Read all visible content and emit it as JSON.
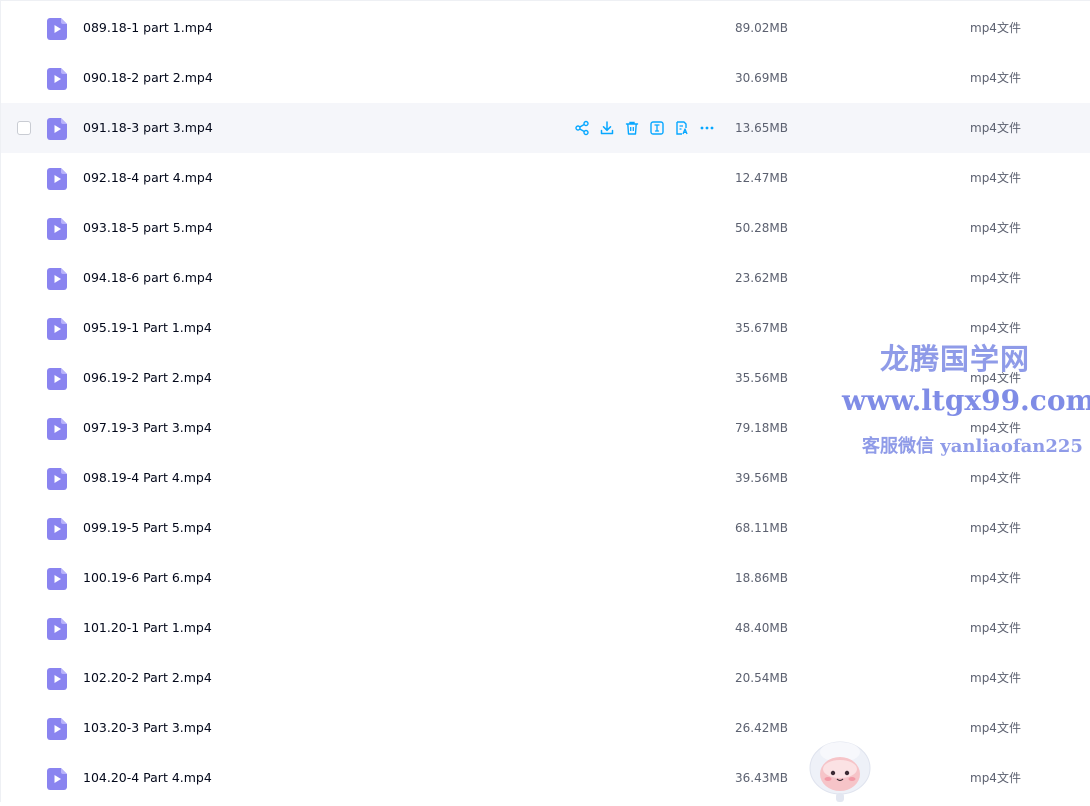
{
  "files": [
    {
      "name": "089.18-1 part 1.mp4",
      "size": "89.02MB",
      "type": "mp4文件"
    },
    {
      "name": "090.18-2 part 2.mp4",
      "size": "30.69MB",
      "type": "mp4文件"
    },
    {
      "name": "091.18-3 part 3.mp4",
      "size": "13.65MB",
      "type": "mp4文件",
      "hovered": true
    },
    {
      "name": "092.18-4 part 4.mp4",
      "size": "12.47MB",
      "type": "mp4文件"
    },
    {
      "name": "093.18-5 part 5.mp4",
      "size": "50.28MB",
      "type": "mp4文件"
    },
    {
      "name": "094.18-6 part 6.mp4",
      "size": "23.62MB",
      "type": "mp4文件"
    },
    {
      "name": "095.19-1 Part 1.mp4",
      "size": "35.67MB",
      "type": "mp4文件"
    },
    {
      "name": "096.19-2 Part 2.mp4",
      "size": "35.56MB",
      "type": "mp4文件"
    },
    {
      "name": "097.19-3 Part 3.mp4",
      "size": "79.18MB",
      "type": "mp4文件"
    },
    {
      "name": "098.19-4 Part 4.mp4",
      "size": "39.56MB",
      "type": "mp4文件"
    },
    {
      "name": "099.19-5 Part 5.mp4",
      "size": "68.11MB",
      "type": "mp4文件"
    },
    {
      "name": "100.19-6 Part 6.mp4",
      "size": "18.86MB",
      "type": "mp4文件"
    },
    {
      "name": "101.20-1 Part 1.mp4",
      "size": "48.40MB",
      "type": "mp4文件"
    },
    {
      "name": "102.20-2 Part 2.mp4",
      "size": "20.54MB",
      "type": "mp4文件"
    },
    {
      "name": "103.20-3 Part 3.mp4",
      "size": "26.42MB",
      "type": "mp4文件"
    },
    {
      "name": "104.20-4 Part 4.mp4",
      "size": "36.43MB",
      "type": "mp4文件"
    }
  ],
  "row_actions": [
    "share-icon",
    "download-icon",
    "delete-icon",
    "rename-icon",
    "copy-to-icon",
    "more-icon"
  ],
  "watermark": {
    "title": "龙腾国学网",
    "url": "www.ltgx99.com",
    "contact": "客服微信 yanliaofan225"
  },
  "colors": {
    "accent": "#06a7ff",
    "file_icon": "#8a84f0",
    "hover_row": "#f5f6fa",
    "watermark": "#8f9be8"
  }
}
